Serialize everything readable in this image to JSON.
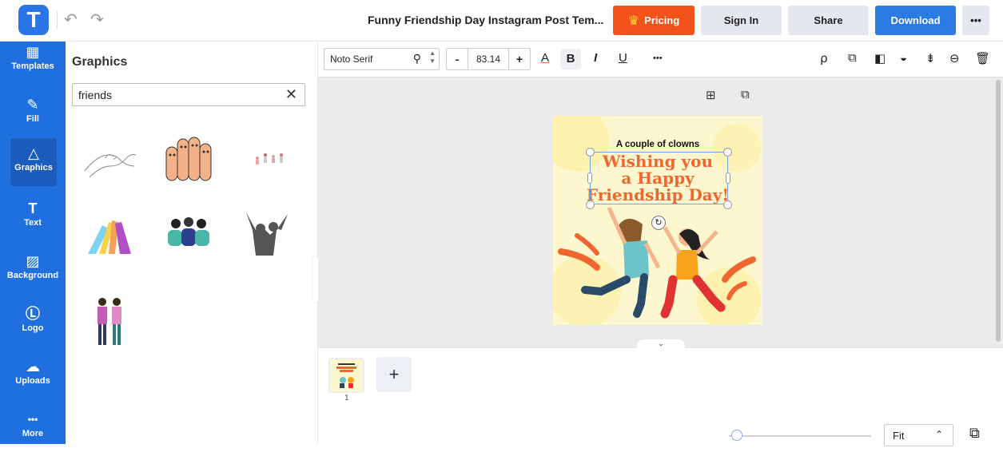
{
  "header": {
    "logo_letter": "T",
    "undo_icon": "undo-icon",
    "redo_icon": "redo-icon",
    "doc_title": "Funny Friendship Day Instagram Post Tem...",
    "pricing_label": "Pricing",
    "signin_label": "Sign In",
    "share_label": "Share",
    "download_label": "Download",
    "more_label": "•••"
  },
  "sidebar": {
    "items": [
      {
        "label": "Templates",
        "icon": "▦"
      },
      {
        "label": "Fill",
        "icon": "✎"
      },
      {
        "label": "Graphics",
        "icon": "△"
      },
      {
        "label": "Text",
        "icon": "T"
      },
      {
        "label": "Background",
        "icon": "▨"
      },
      {
        "label": "Logo",
        "icon": "Ⓛ"
      },
      {
        "label": "Uploads",
        "icon": "☁"
      },
      {
        "label": "More",
        "icon": "•••"
      }
    ]
  },
  "panel": {
    "title": "Graphics",
    "search_value": "friends",
    "clear_icon": "✕"
  },
  "toolbar": {
    "font_name": "Noto Serif",
    "minus": "-",
    "font_size": "83.14",
    "plus": "+",
    "color_glyph": "A",
    "bold_glyph": "B",
    "italic_glyph": "I",
    "underline_glyph": "U",
    "more_glyph": "•••"
  },
  "design": {
    "subtitle": "A couple of clowns",
    "main_line1": "Wishing you",
    "main_line2": "a Happy",
    "main_line3": "Friendship Day!"
  },
  "pages": {
    "page_number": "1",
    "add_label": "+"
  },
  "zoom": {
    "label": "Fit",
    "level": 0.02
  },
  "colors": {
    "brand_blue": "#1f6fde",
    "pricing_orange": "#f2531a",
    "download_blue": "#2c7be5",
    "title_orange": "#f0662f"
  }
}
